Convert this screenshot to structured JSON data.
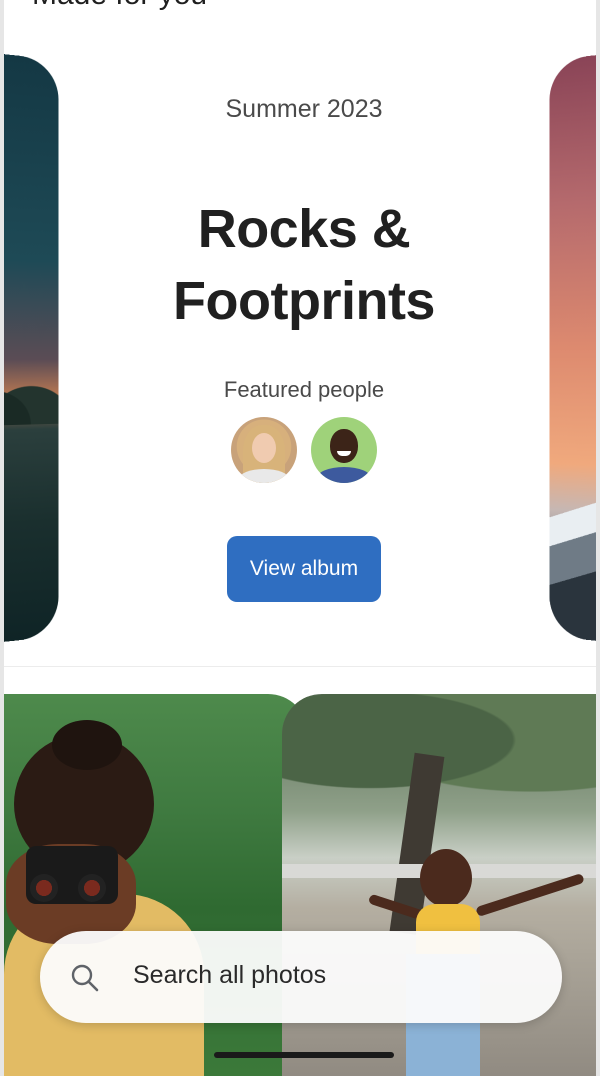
{
  "section": {
    "title": "Made for you"
  },
  "card": {
    "subtitle": "Summer 2023",
    "title_line1": "Rocks &",
    "title_line2": "Footprints",
    "featured_label": "Featured people",
    "view_button": "View album"
  },
  "search": {
    "placeholder": "Search all photos",
    "icon": "search-icon"
  },
  "colors": {
    "accent": "#2f6ec1",
    "text_primary": "#202020",
    "text_secondary": "#4a4a4a"
  }
}
